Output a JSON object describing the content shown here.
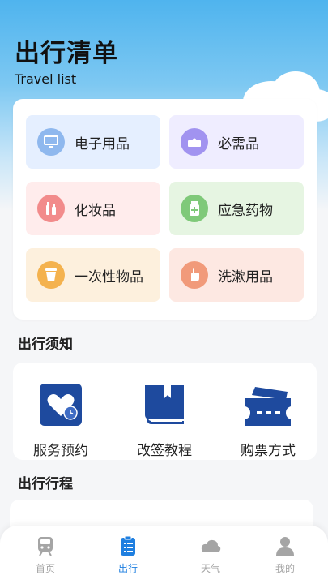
{
  "header": {
    "title": "出行清单",
    "subtitle": "Travel list"
  },
  "categories": [
    {
      "label": "电子用品",
      "icon": "monitor-icon",
      "bg": "#e5efff",
      "icon_color": "#8fb8ee"
    },
    {
      "label": "必需品",
      "icon": "tissue-box-icon",
      "bg": "#efedff",
      "icon_color": "#a193f0"
    },
    {
      "label": "化妆品",
      "icon": "cosmetics-icon",
      "bg": "#ffecec",
      "icon_color": "#f28b8b"
    },
    {
      "label": "应急药物",
      "icon": "medicine-bottle-icon",
      "bg": "#e6f5e2",
      "icon_color": "#7fc979"
    },
    {
      "label": "一次性物品",
      "icon": "disposable-cup-icon",
      "bg": "#fdf0dd",
      "icon_color": "#f4b24e"
    },
    {
      "label": "洗漱用品",
      "icon": "hand-wash-icon",
      "bg": "#fde8e2",
      "icon_color": "#f19a7a"
    }
  ],
  "notice": {
    "title": "出行须知",
    "items": [
      {
        "label": "服务预约",
        "icon": "heart-clock-icon"
      },
      {
        "label": "改签教程",
        "icon": "book-icon"
      },
      {
        "label": "购票方式",
        "icon": "ticket-icon"
      }
    ]
  },
  "itinerary": {
    "title": "出行行程"
  },
  "tabs": [
    {
      "label": "首页",
      "icon": "train-icon",
      "active": false
    },
    {
      "label": "出行",
      "icon": "clipboard-list-icon",
      "active": true
    },
    {
      "label": "天气",
      "icon": "cloud-icon",
      "active": false
    },
    {
      "label": "我的",
      "icon": "person-icon",
      "active": false
    }
  ],
  "colors": {
    "accent": "#1f7fe0",
    "notice_icon": "#1e4a9e",
    "tab_inactive": "#a5a5a5"
  }
}
